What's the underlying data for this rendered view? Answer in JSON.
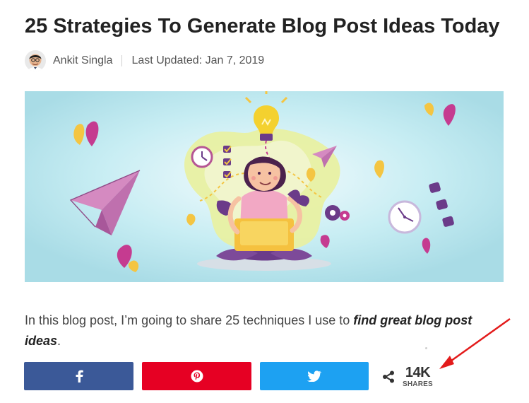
{
  "article": {
    "title": "25 Strategies To Generate Blog Post Ideas Today",
    "author": "Ankit Singla",
    "updated_label": "Last Updated:",
    "updated_date": "Jan 7, 2019",
    "intro_prefix": "In this blog post, I’m going to share 25 techniques I use to ",
    "intro_emphasis": "find great blog post ideas",
    "intro_suffix": "."
  },
  "share": {
    "facebook_icon": "facebook-icon",
    "pinterest_icon": "pinterest-icon",
    "twitter_icon": "twitter-icon",
    "share_icon": "share-icon",
    "count": "14K",
    "count_label": "SHARES"
  },
  "colors": {
    "facebook": "#3b5998",
    "pinterest": "#e60023",
    "twitter": "#1da1f2",
    "annotation_arrow": "#e31b1b",
    "hero_background": "#bfe7ef"
  }
}
